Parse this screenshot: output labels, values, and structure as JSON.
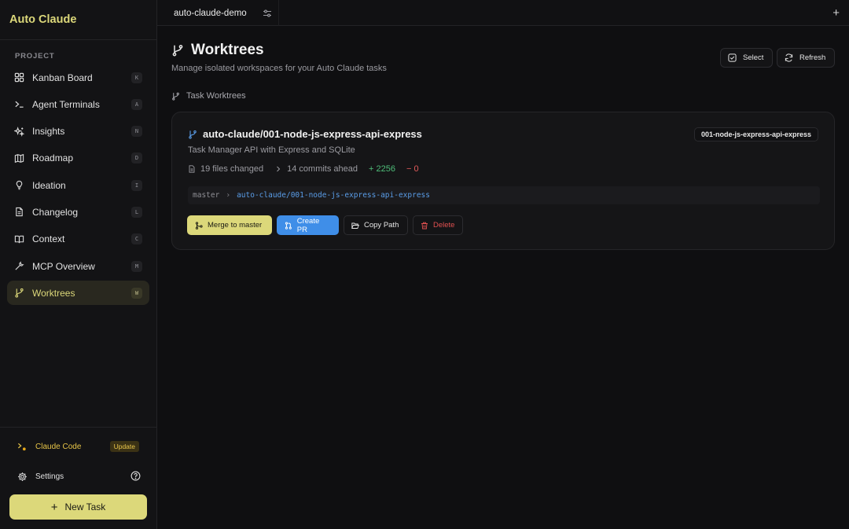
{
  "app": {
    "title": "Auto Claude"
  },
  "sidebar": {
    "section_label": "PROJECT",
    "items": [
      {
        "label": "Kanban Board",
        "shortcut": "K",
        "icon": "grid-icon"
      },
      {
        "label": "Agent Terminals",
        "shortcut": "A",
        "icon": "terminal-icon"
      },
      {
        "label": "Insights",
        "shortcut": "N",
        "icon": "sparkles-icon"
      },
      {
        "label": "Roadmap",
        "shortcut": "D",
        "icon": "map-icon"
      },
      {
        "label": "Ideation",
        "shortcut": "I",
        "icon": "lightbulb-icon"
      },
      {
        "label": "Changelog",
        "shortcut": "L",
        "icon": "file-text-icon"
      },
      {
        "label": "Context",
        "shortcut": "C",
        "icon": "book-open-icon"
      },
      {
        "label": "MCP Overview",
        "shortcut": "M",
        "icon": "wrench-icon"
      },
      {
        "label": "Worktrees",
        "shortcut": "W",
        "icon": "git-branch-icon",
        "active": true
      }
    ],
    "claude_code": {
      "label": "Claude Code",
      "badge": "Update"
    },
    "settings": {
      "label": "Settings"
    },
    "new_task": {
      "label": "New Task"
    }
  },
  "topbar": {
    "tab_label": "auto-claude-demo"
  },
  "main": {
    "title": "Worktrees",
    "subtitle": "Manage isolated workspaces for your Auto Claude tasks",
    "select_label": "Select",
    "refresh_label": "Refresh",
    "section_title": "Task Worktrees",
    "worktree": {
      "branch": "auto-claude/001-node-js-express-api-express",
      "chip": "001-node-js-express-api-express",
      "description": "Task Manager API with Express and SQLite",
      "files_changed": "19 files changed",
      "commits_ahead": "14 commits ahead",
      "additions": "+ 2256",
      "deletions": "− 0",
      "base": "master",
      "target": "auto-claude/001-node-js-express-api-express",
      "actions": {
        "merge": "Merge to master",
        "create_pr": "Create PR",
        "copy_path": "Copy Path",
        "delete": "Delete"
      }
    }
  },
  "colors": {
    "accent": "#dcd87a",
    "pr_blue": "#3f8ee8",
    "add_green": "#4fbf7a",
    "delete_red": "#e05050"
  }
}
